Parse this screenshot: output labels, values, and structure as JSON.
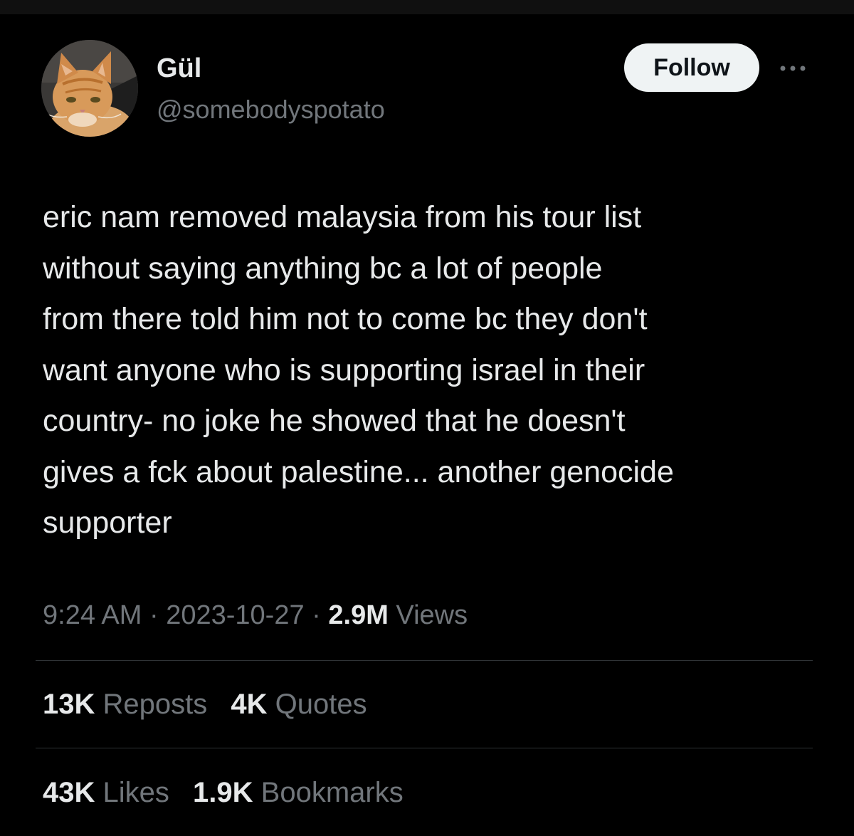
{
  "tweet": {
    "author": {
      "display_name": "Gül",
      "handle": "@somebodyspotato",
      "avatar_icon": "orange-cat-avatar"
    },
    "follow_label": "Follow",
    "more_icon": "more-horizontal-icon",
    "text": "eric nam removed malaysia from his tour list\nwithout saying anything bc a lot of people\nfrom there told him not to come bc they don't\nwant anyone who is supporting israel in their\ncountry- no joke he showed that he doesn't\ngives a fck about palestine... another genocide\nsupporter",
    "time": "9:24 AM",
    "date": "2023-10-27",
    "separator": "·",
    "views_count": "2.9M",
    "views_label": "Views"
  },
  "stats": {
    "reposts": {
      "count": "13K",
      "label": "Reposts"
    },
    "quotes": {
      "count": "4K",
      "label": "Quotes"
    },
    "likes": {
      "count": "43K",
      "label": "Likes"
    },
    "bookmarks": {
      "count": "1.9K",
      "label": "Bookmarks"
    }
  },
  "colors": {
    "background": "#000000",
    "primary_text": "#e7e9ea",
    "secondary_text": "#71767b",
    "divider": "#2f3336",
    "follow_button_bg": "#eff3f4",
    "follow_button_text": "#0f1419"
  }
}
